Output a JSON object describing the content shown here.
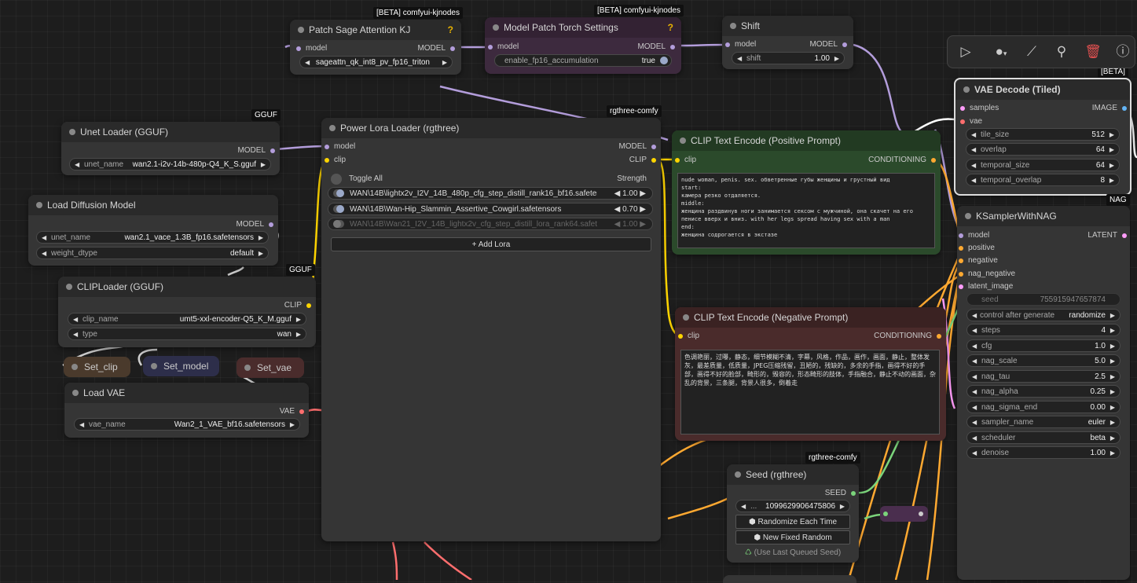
{
  "colors": {
    "model": "#b39ddb",
    "clip": "#ffd500",
    "conditioning": "#ffa931",
    "vae": "#ff6e6e",
    "latent": "#ff9cf9",
    "image": "#64b5f6",
    "int": "#7bd47b"
  },
  "toolbar": {
    "icons": [
      "play-icon",
      "circle-dropdown-icon",
      "magic-wand-icon",
      "pin-icon",
      "trash-icon",
      "help-icon"
    ]
  },
  "patch_sage": {
    "badge": "[BETA] comfyui-kjnodes",
    "title": "Patch Sage Attention KJ",
    "help": "?",
    "in_model": "model",
    "out_model": "MODEL",
    "widget_value": "sageattn_qk_int8_pv_fp16_triton"
  },
  "patch_torch": {
    "badge": "[BETA] comfyui-kjnodes",
    "title": "Model Patch Torch Settings",
    "help": "?",
    "in_model": "model",
    "out_model": "MODEL",
    "widget_name": "enable_fp16_accumulation",
    "widget_value": "true"
  },
  "shift": {
    "title": "Shift",
    "in_model": "model",
    "out_model": "MODEL",
    "widget_name": "shift",
    "widget_value": "1.00"
  },
  "unet_gguf": {
    "badge": "GGUF",
    "title": "Unet Loader (GGUF)",
    "out_model": "MODEL",
    "widget_name": "unet_name",
    "widget_value": "wan2.1-i2v-14b-480p-Q4_K_S.gguf"
  },
  "load_diffusion": {
    "title": "Load Diffusion Model",
    "out_model": "MODEL",
    "w1_name": "unet_name",
    "w1_value": "wan2.1_vace_1.3B_fp16.safetensors",
    "w2_name": "weight_dtype",
    "w2_value": "default"
  },
  "clip_loader": {
    "badge": "GGUF",
    "title": "CLIPLoader (GGUF)",
    "out_clip": "CLIP",
    "w1_name": "clip_name",
    "w1_value": "umt5-xxl-encoder-Q5_K_M.gguf",
    "w2_name": "type",
    "w2_value": "wan"
  },
  "set_nodes": {
    "clip": "Set_clip",
    "model": "Set_model",
    "vae": "Set_vae"
  },
  "load_vae": {
    "title": "Load VAE",
    "out_vae": "VAE",
    "widget_name": "vae_name",
    "widget_value": "Wan2_1_VAE_bf16.safetensors"
  },
  "power_lora": {
    "badge": "rgthree-comfy",
    "title": "Power Lora Loader (rgthree)",
    "in_model": "model",
    "in_clip": "clip",
    "out_model": "MODEL",
    "out_clip": "CLIP",
    "toggle_all": "Toggle All",
    "strength": "Strength",
    "loras": [
      {
        "name": "WAN\\14B\\lightx2v_I2V_14B_480p_cfg_step_distill_rank16_bf16.safetensors",
        "value": "1.00",
        "on": true
      },
      {
        "name": "WAN\\14B\\Wan-Hip_Slammin_Assertive_Cowgirl.safetensors",
        "value": "0.70",
        "on": true
      },
      {
        "name": "WAN\\14B\\Wan21_I2V_14B_lightx2v_cfg_step_distill_lora_rank64.safetens...",
        "value": "1.00",
        "on": false
      }
    ],
    "add_lora": "Add Lora"
  },
  "clip_pos": {
    "title": "CLIP Text Encode (Positive Prompt)",
    "in_clip": "clip",
    "out_cond": "CONDITIONING",
    "text": "nude woman, penis. sex. обветренные губы женщины и грустный вид\nstart:\nкамера резко отдаляется.\nmiddle:\nженщина раздвинув ноги занимается сексом с мужчиной, она скачет на его\nпенисе вверх и вниз. with her legs spread having sex with a man\nend:\nженщина содрогается в экстазе"
  },
  "clip_neg": {
    "title": "CLIP Text Encode (Negative Prompt)",
    "in_clip": "clip",
    "out_cond": "CONDITIONING",
    "text": "色调艳丽，过曝，静态，细节模糊不清，字幕，风格，作品，画作，画面，静止，整体发灰，最差质量，低质量，JPEG压缩残留，丑陋的，残缺的，多余的手指，画得不好的手部，画得不好的脸部，畸形的，毁容的，形态畸形的肢体，手指融合，静止不动的画面，杂乱的背景，三条腿，背景人很多，倒着走"
  },
  "vae_decode": {
    "badge": "[BETA]",
    "title": "VAE Decode (Tiled)",
    "in_samples": "samples",
    "in_vae": "vae",
    "out_image": "IMAGE",
    "widgets": [
      {
        "name": "tile_size",
        "value": "512"
      },
      {
        "name": "overlap",
        "value": "64"
      },
      {
        "name": "temporal_size",
        "value": "64"
      },
      {
        "name": "temporal_overlap",
        "value": "8"
      }
    ]
  },
  "ksampler": {
    "badge": "NAG",
    "title": "KSamplerWithNAG",
    "inputs": [
      "model",
      "positive",
      "negative",
      "nag_negative",
      "latent_image"
    ],
    "out_latent": "LATENT",
    "seed_name": "seed",
    "seed_value": "755915947657874",
    "widgets": [
      {
        "name": "control after generate",
        "value": "randomize"
      },
      {
        "name": "steps",
        "value": "4"
      },
      {
        "name": "cfg",
        "value": "1.0"
      },
      {
        "name": "nag_scale",
        "value": "5.0"
      },
      {
        "name": "nag_tau",
        "value": "2.5"
      },
      {
        "name": "nag_alpha",
        "value": "0.25"
      },
      {
        "name": "nag_sigma_end",
        "value": "0.00"
      },
      {
        "name": "sampler_name",
        "value": "euler"
      },
      {
        "name": "scheduler",
        "value": "beta"
      },
      {
        "name": "denoise",
        "value": "1.00"
      }
    ]
  },
  "seed_node": {
    "badge": "rgthree-comfy",
    "title": "Seed (rgthree)",
    "out_seed": "SEED",
    "widget_prefix": "...",
    "widget_value": "1099629906475806",
    "btn_randomize": "Randomize Each Time",
    "btn_new": "New Fixed Random",
    "btn_last": "(Use Last Queued Seed)"
  }
}
